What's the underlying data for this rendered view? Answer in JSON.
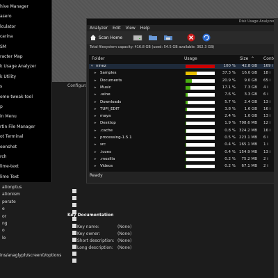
{
  "app_menu": {
    "items": [
      "hive Manager",
      "asero",
      "lculator",
      "carina",
      "SM",
      "racter Map",
      "k Usage Analyzer",
      "k Utility",
      "s",
      "ome-tweak-tool",
      "p",
      "in Menu",
      "rtin File Manager",
      "ot Terminal",
      "eenshot",
      "rch",
      "lime-text",
      "lime Text"
    ]
  },
  "config_editor": {
    "header": "Configura",
    "left_labels": [
      "ationptus",
      "ationism",
      "porate",
      "e",
      "or",
      "ng",
      "o",
      "le"
    ],
    "key_documentation": {
      "title": "Key Documentation",
      "rows": [
        {
          "label": "Key name:",
          "value": "(None)"
        },
        {
          "label": "Key owner:",
          "value": "(None)"
        },
        {
          "label": "Short description:",
          "value": "(None)"
        },
        {
          "label": "Long description:",
          "value": "(None)"
        }
      ]
    },
    "status_path": "ins/anaglyph/screen0/options"
  },
  "disk_usage_analyzer": {
    "title": "Disk Usage Analyzer",
    "menu": [
      "Analyzer",
      "Edit",
      "View",
      "Help"
    ],
    "toolbar": {
      "scan_home_label": "Scan Home"
    },
    "capacity_text": "Total filesystem capacity: 416.8 GB (used: 54.5 GB available: 362.3 GB)",
    "columns": {
      "folder": "Folder",
      "usage": "Usage",
      "size": "Size",
      "contents": "Conten"
    },
    "rows": [
      {
        "name": "ninez",
        "pct": "100 %",
        "size": "42.8 GB",
        "contents": "169 i",
        "fill": 1.0,
        "color": "#cc0000",
        "expanded": true
      },
      {
        "name": "Samples",
        "pct": "37.3 %",
        "size": "16.0 GB",
        "contents": "18 i",
        "fill": 0.37,
        "color": "#e8c000"
      },
      {
        "name": "Documents",
        "pct": "20.9 %",
        "size": "9.0 GB",
        "contents": "65 i",
        "fill": 0.21,
        "color": "#4ab010"
      },
      {
        "name": "Music",
        "pct": "17.1 %",
        "size": "7.3 GB",
        "contents": "4 i",
        "fill": 0.17,
        "color": "#4ab010"
      },
      {
        "name": ".wine",
        "pct": "7.6 %",
        "size": "3.3 GB",
        "contents": "6 i",
        "fill": 0.08,
        "color": "#4ab010"
      },
      {
        "name": "Downloads",
        "pct": "5.7 %",
        "size": "2.4 GB",
        "contents": "13 i",
        "fill": 0.06,
        "color": "#4ab010"
      },
      {
        "name": "TUPI_EDIT",
        "pct": "3.8 %",
        "size": "1.6 GB",
        "contents": "16 i",
        "fill": 0.04,
        "color": "#4ab010"
      },
      {
        "name": "maya",
        "pct": "2.4 %",
        "size": "1.0 GB",
        "contents": "13 i",
        "fill": 0.024,
        "color": "#4ab010"
      },
      {
        "name": "Desktop",
        "pct": "1.9 %",
        "size": "798.6 MB",
        "contents": "12 i",
        "fill": 0.019,
        "color": "#4ab010"
      },
      {
        "name": ".cache",
        "pct": "0.8 %",
        "size": "324.2 MB",
        "contents": "16 i",
        "fill": 0.008,
        "color": "#4ab010"
      },
      {
        "name": "processing-1.5.1",
        "pct": "0.5 %",
        "size": "223.1 MB",
        "contents": "6 i",
        "fill": 0.005,
        "color": "#4ab010"
      },
      {
        "name": "src",
        "pct": "0.4 %",
        "size": "165.1 MB",
        "contents": "1 i",
        "fill": 0.004,
        "color": "#4ab010"
      },
      {
        "name": ".icons",
        "pct": "0.4 %",
        "size": "154.9 MB",
        "contents": "13 i",
        "fill": 0.004,
        "color": "#4ab010"
      },
      {
        "name": ".mozilla",
        "pct": "0.2 %",
        "size": "75.2 MB",
        "contents": "2 i",
        "fill": 0.002,
        "color": "#4ab010"
      },
      {
        "name": "Videos",
        "pct": "0.2 %",
        "size": "67.1 MB",
        "contents": "2 i",
        "fill": 0.002,
        "color": "#4ab010"
      }
    ],
    "status": "Ready"
  }
}
